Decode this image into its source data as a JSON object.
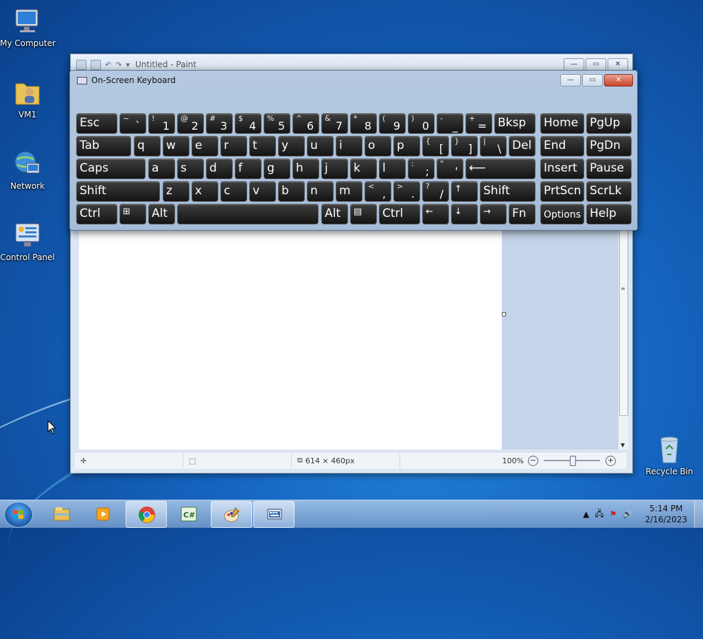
{
  "desktop": {
    "icons": [
      {
        "label": "My Computer",
        "icon": "computer-icon"
      },
      {
        "label": "VM1",
        "icon": "user-folder-icon"
      },
      {
        "label": "Network",
        "icon": "network-icon"
      },
      {
        "label": "Control Panel",
        "icon": "control-panel-icon"
      },
      {
        "label": "Recycle Bin",
        "icon": "recycle-bin-icon"
      }
    ]
  },
  "paint": {
    "title": "Untitled - Paint",
    "status": {
      "image_size": "614 × 460px",
      "zoom": "100%"
    }
  },
  "osk": {
    "title": "On-Screen Keyboard",
    "rows": [
      [
        {
          "label": "Esc"
        },
        {
          "shift": "~",
          "label": "`"
        },
        {
          "shift": "!",
          "label": "1"
        },
        {
          "shift": "@",
          "label": "2"
        },
        {
          "shift": "#",
          "label": "3"
        },
        {
          "shift": "$",
          "label": "4"
        },
        {
          "shift": "%",
          "label": "5"
        },
        {
          "shift": "^",
          "label": "6"
        },
        {
          "shift": "&",
          "label": "7"
        },
        {
          "shift": "*",
          "label": "8"
        },
        {
          "shift": "(",
          "label": "9"
        },
        {
          "shift": ")",
          "label": "0"
        },
        {
          "shift": "-",
          "label": "_"
        },
        {
          "shift": "+",
          "label": "="
        },
        {
          "label": "Bksp"
        },
        {
          "label": "Home"
        },
        {
          "label": "PgUp"
        }
      ],
      [
        {
          "label": "Tab"
        },
        {
          "label": "q"
        },
        {
          "label": "w"
        },
        {
          "label": "e"
        },
        {
          "label": "r"
        },
        {
          "label": "t"
        },
        {
          "label": "y"
        },
        {
          "label": "u"
        },
        {
          "label": "i"
        },
        {
          "label": "o"
        },
        {
          "label": "p"
        },
        {
          "shift": "{",
          "label": "["
        },
        {
          "shift": "}",
          "label": "]"
        },
        {
          "shift": "|",
          "label": "\\"
        },
        {
          "label": "Del"
        },
        {
          "label": "End"
        },
        {
          "label": "PgDn"
        }
      ],
      [
        {
          "label": "Caps"
        },
        {
          "label": "a"
        },
        {
          "label": "s"
        },
        {
          "label": "d"
        },
        {
          "label": "f"
        },
        {
          "label": "g"
        },
        {
          "label": "h"
        },
        {
          "label": "j"
        },
        {
          "label": "k"
        },
        {
          "label": "l"
        },
        {
          "shift": ":",
          "label": ";"
        },
        {
          "shift": "\"",
          "label": "'"
        },
        {
          "label": "⟵"
        },
        {
          "label": "Insert"
        },
        {
          "label": "Pause"
        }
      ],
      [
        {
          "label": "Shift"
        },
        {
          "label": "z"
        },
        {
          "label": "x"
        },
        {
          "label": "c"
        },
        {
          "label": "v"
        },
        {
          "label": "b"
        },
        {
          "label": "n"
        },
        {
          "label": "m"
        },
        {
          "shift": "<",
          "label": ","
        },
        {
          "shift": ">",
          "label": "."
        },
        {
          "shift": "?",
          "label": "/"
        },
        {
          "label": "↑"
        },
        {
          "label": "Shift"
        },
        {
          "label": "PrtScn"
        },
        {
          "label": "ScrLk"
        }
      ],
      [
        {
          "label": "Ctrl"
        },
        {
          "label": "⊞"
        },
        {
          "label": "Alt"
        },
        {
          "label": ""
        },
        {
          "label": "Alt"
        },
        {
          "label": "▤"
        },
        {
          "label": "Ctrl"
        },
        {
          "label": "←"
        },
        {
          "label": "↓"
        },
        {
          "label": "→"
        },
        {
          "label": "Fn"
        },
        {
          "label": "Options"
        },
        {
          "label": "Help"
        }
      ]
    ]
  },
  "taskbar": {
    "apps": [
      {
        "name": "File Explorer",
        "icon": "explorer-icon"
      },
      {
        "name": "Media Player",
        "icon": "media-player-icon"
      },
      {
        "name": "Chrome",
        "icon": "chrome-icon"
      },
      {
        "name": "C#",
        "icon": "csharp-icon"
      },
      {
        "name": "Paint",
        "icon": "paint-icon"
      },
      {
        "name": "On-Screen Keyboard",
        "icon": "keyboard-icon"
      }
    ],
    "clock": {
      "time": "5:14 PM",
      "date": "2/16/2023"
    }
  }
}
